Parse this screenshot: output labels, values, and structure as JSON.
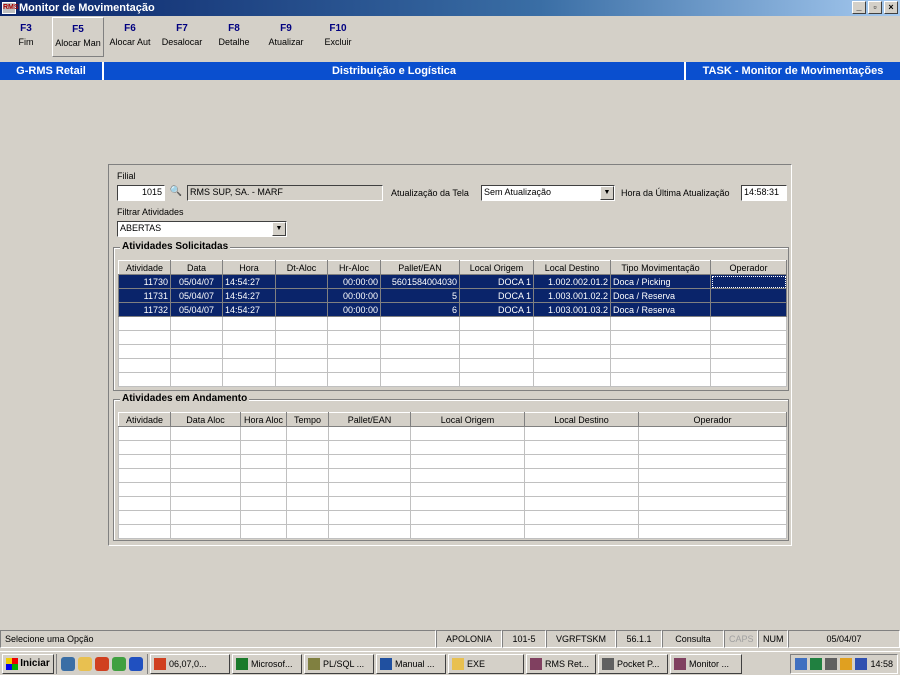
{
  "window": {
    "title": "Monitor de Movimentação",
    "app_icon": "RMS"
  },
  "fkeys": [
    {
      "key": "F3",
      "label": "Fim"
    },
    {
      "key": "F5",
      "label": "Alocar Man"
    },
    {
      "key": "F6",
      "label": "Alocar Aut"
    },
    {
      "key": "F7",
      "label": "Desalocar"
    },
    {
      "key": "F8",
      "label": "Detalhe"
    },
    {
      "key": "F9",
      "label": "Atualizar"
    },
    {
      "key": "F10",
      "label": "Excluir"
    }
  ],
  "banner": {
    "left": "G-RMS Retail",
    "center": "Distribuição e Logística",
    "right": "TASK - Monitor de Movimentações"
  },
  "form": {
    "filial_label": "Filial",
    "filial_code": "1015",
    "filial_name": "RMS SUP, SA. - MARF",
    "atualizacao_label": "Atualização da Tela",
    "atualizacao_value": "Sem Atualização",
    "hora_label": "Hora da Última Atualização",
    "hora_value": "14:58:31",
    "filtrar_label": "Filtrar Atividades",
    "filtrar_value": "ABERTAS"
  },
  "solicitadas": {
    "title": "Atividades Solicitadas",
    "columns": [
      "Atividade",
      "Data",
      "Hora",
      "Dt-Aloc",
      "Hr-Aloc",
      "Pallet/EAN",
      "Local Origem",
      "Local Destino",
      "Tipo Movimentação",
      "Operador"
    ],
    "rows": [
      [
        "11730",
        "05/04/07",
        "14:54:27",
        "",
        "00:00:00",
        "5601584004030",
        "DOCA 1",
        "1.002.002.01.2",
        "Doca / Picking",
        ""
      ],
      [
        "11731",
        "05/04/07",
        "14:54:27",
        "",
        "00:00:00",
        "5",
        "DOCA 1",
        "1.003.001.02.2",
        "Doca / Reserva",
        ""
      ],
      [
        "11732",
        "05/04/07",
        "14:54:27",
        "",
        "00:00:00",
        "6",
        "DOCA 1",
        "1.003.001.03.2",
        "Doca / Reserva",
        ""
      ]
    ]
  },
  "andamento": {
    "title": "Atividades em Andamento",
    "columns": [
      "Atividade",
      "Data Aloc",
      "Hora Aloc",
      "Tempo",
      "Pallet/EAN",
      "Local Origem",
      "Local Destino",
      "Operador"
    ],
    "rows": []
  },
  "statusbar": {
    "message": "Selecione uma Opção",
    "server": "APOLONIA",
    "code": "101-5",
    "user": "VGRFTSKM",
    "version": "56.1.1",
    "mode": "Consulta",
    "caps": "CAPS",
    "num": "NUM",
    "date": "05/04/07"
  },
  "taskbar": {
    "start": "Iniciar",
    "tasks": [
      "06,07,0...",
      "Microsof...",
      "PL/SQL ...",
      "Manual ...",
      "EXE",
      "RMS Ret...",
      "Pocket P...",
      "Monitor ..."
    ],
    "clock": "14:58"
  }
}
